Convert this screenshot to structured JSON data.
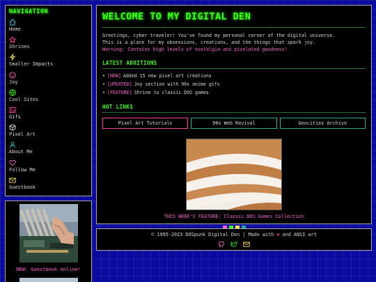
{
  "sidebar": {
    "title": "NAVIGATION",
    "items": [
      {
        "label": "Home",
        "icon": "home-icon",
        "color": "#35c8ff"
      },
      {
        "label": "Shrines",
        "icon": "star-icon",
        "color": "#ff3fa0"
      },
      {
        "label": "Smaller Impacts",
        "icon": "lightning-icon",
        "color": "#ffe94a"
      },
      {
        "label": "Joy",
        "icon": "smile-icon",
        "color": "#ff5fd2"
      },
      {
        "label": "Cool Sites",
        "icon": "globe-icon",
        "color": "#39ff14"
      },
      {
        "label": "Gifs",
        "icon": "image-icon",
        "color": "#ff3fa0"
      },
      {
        "label": "Pixel Art",
        "icon": "cube-icon",
        "color": "#ffffff"
      },
      {
        "label": "About Me",
        "icon": "user-icon",
        "color": "#1fd0b8"
      },
      {
        "label": "Follow Me",
        "icon": "heart-icon",
        "color": "#ff5fd2"
      },
      {
        "label": "Guestbook",
        "icon": "mail-icon",
        "color": "#ffe94a"
      }
    ]
  },
  "sidebar2": {
    "note": "NEW: Guestbook online!"
  },
  "main": {
    "title": "WELCOME TO MY DIGITAL DEN",
    "intro_line1": "Greetings, cyber traveler! You've found my personal corner of the digital universe.",
    "intro_line2": "This is a place for my obsessions, creations, and the things that spark joy.",
    "warning": "Warning: Contains high levels of nostalgia and pixelated goodness!",
    "latest_title": "LATEST ADDITIONS",
    "updates": [
      {
        "tag": "[NEW]",
        "text": "Added 15 new pixel art creations"
      },
      {
        "tag": "[UPDATED]",
        "text": "Joy section with 90s anime gifs"
      },
      {
        "tag": "[FEATURE]",
        "text": "Shrine to classic DOS games"
      }
    ],
    "hot_title": "HOT LINKS",
    "links": [
      "Pixel Art Tutorials",
      "90s Web Revival",
      "Geocities Archive"
    ],
    "feature_caption": "THIS WEEK'S FEATURE: Classic DOS Games Collection",
    "dot_colors": [
      "#ff5fd2",
      "#39ff14",
      "#ffe94a",
      "#1fae9a"
    ]
  },
  "footer": {
    "text_before": "© 1995-2023 DOSpunk Digital Den | Made with",
    "heart": "❤",
    "text_after": "and ANSI art",
    "icons": [
      "github-icon",
      "twitter-icon",
      "mail-icon"
    ]
  },
  "colors": {
    "accent_green": "#39ff14",
    "accent_pink": "#ff5fd2",
    "background_blue": "#0a0a9e"
  }
}
